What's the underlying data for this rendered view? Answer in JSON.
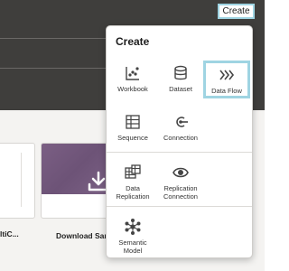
{
  "header": {
    "create_button_label": "Create"
  },
  "cards": [
    {
      "title": "ltiC..."
    },
    {
      "title": "Download San"
    }
  ],
  "create_menu": {
    "title": "Create",
    "items": [
      {
        "label": "Workbook",
        "icon": "workbook-icon"
      },
      {
        "label": "Dataset",
        "icon": "dataset-icon"
      },
      {
        "label": "Data Flow",
        "icon": "data-flow-icon",
        "selected": true
      },
      {
        "label": "Sequence",
        "icon": "sequence-icon"
      },
      {
        "label": "Connection",
        "icon": "connection-icon"
      },
      {
        "label": "Data Replication",
        "icon": "data-replication-icon"
      },
      {
        "label": "Replication Connection",
        "icon": "replication-connection-icon"
      },
      {
        "label": "Semantic Model",
        "icon": "semantic-model-icon"
      }
    ]
  },
  "colors": {
    "header_bg": "#3f3e3c",
    "highlight": "#9fd4e2",
    "card_banner": "#735a7d"
  }
}
